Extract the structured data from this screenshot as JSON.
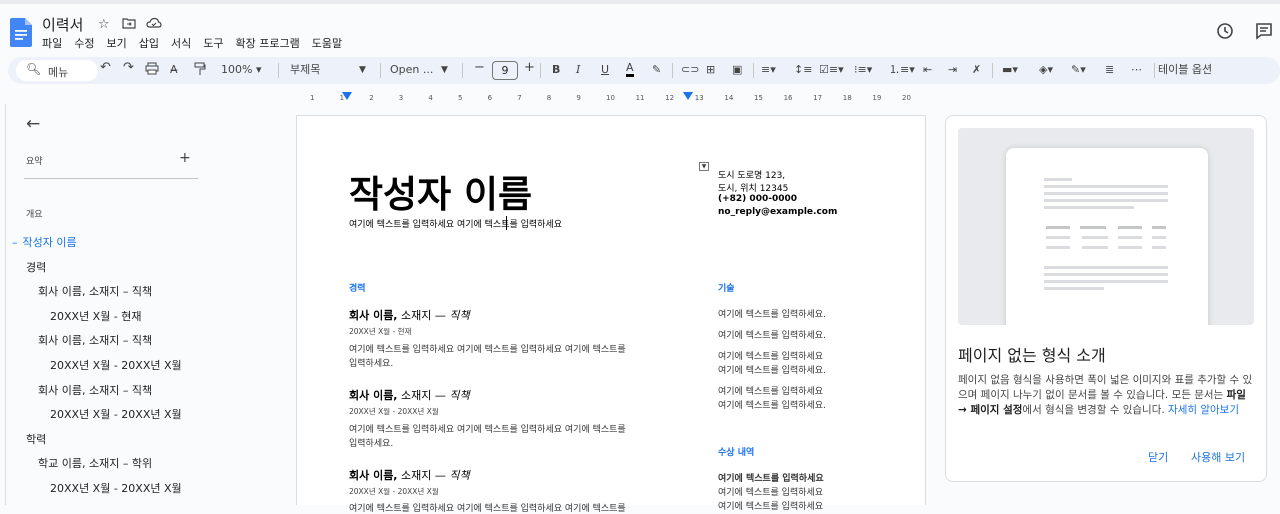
{
  "app": {
    "title": "이력서",
    "menu": [
      "파일",
      "수정",
      "보기",
      "삽입",
      "서식",
      "도구",
      "확장 프로그램",
      "도움말"
    ],
    "icons": [
      "star-icon",
      "move-to-folder-icon",
      "cloud-status-icon",
      "history-icon",
      "comments-icon"
    ]
  },
  "toolbar": {
    "search_label": "메뉴",
    "zoom": "100%",
    "style": "부제목",
    "font": "Open ...",
    "font_size": "9",
    "table_options": "테이블 옵션",
    "colors": {
      "accent": "#1a73e8",
      "toolbar_bg": "#edf2fa"
    }
  },
  "ruler": {
    "ticks": [
      "1",
      "1",
      "2",
      "3",
      "4",
      "5",
      "6",
      "7",
      "8",
      "9",
      "10",
      "11",
      "12",
      "13",
      "14",
      "15",
      "16",
      "17",
      "18",
      "19",
      "20"
    ]
  },
  "outline": {
    "summary_label": "요약",
    "overview_label": "개요",
    "items": [
      {
        "label": "작성자 이름",
        "level": 0,
        "active": true,
        "prefix": "–"
      },
      {
        "label": "경력",
        "level": 1
      },
      {
        "label": "회사 이름, 소재지 – 직책",
        "level": 2
      },
      {
        "label": "20XX년 X월 - 현재",
        "level": 3
      },
      {
        "label": "회사 이름, 소재지 – 직책",
        "level": 2
      },
      {
        "label": "20XX년 X월 - 20XX년 X월",
        "level": 3
      },
      {
        "label": "회사 이름, 소재지 – 직책",
        "level": 2
      },
      {
        "label": "20XX년 X월 - 20XX년 X월",
        "level": 3
      },
      {
        "label": "학력",
        "level": 1
      },
      {
        "label": "학교 이름, 소재지 – 학위",
        "level": 2
      },
      {
        "label": "20XX년 X월 - 20XX년 X월",
        "level": 3
      }
    ]
  },
  "document": {
    "author_name": "작성자 이름",
    "author_sub": "여기에 텍스트를 입력하세요 여기에 텍스트를 입력하세요",
    "contact": [
      "도시 도로명 123,",
      "도시, 위치 12345",
      "(+82) 000-0000",
      "no_reply@example.com"
    ],
    "experience_heading": "경력",
    "jobs": [
      {
        "company": "회사 이름,",
        "location": " 소재지 — ",
        "role": "직책",
        "dates": "20XX년 X월 - 현재",
        "desc1": "여기에 텍스트를 입력하세요 여기에 텍스트를 입력하세요 여기에 텍스트를",
        "desc2": "입력하세요."
      },
      {
        "company": "회사 이름,",
        "location": " 소재지 — ",
        "role": "직책",
        "dates": "20XX년 X월 - 20XX년 X월",
        "desc1": "여기에 텍스트를 입력하세요 여기에 텍스트를 입력하세요 여기에 텍스트를",
        "desc2": "입력하세요."
      },
      {
        "company": "회사 이름,",
        "location": " 소재지 — ",
        "role": "직책",
        "dates": "20XX년 X월 - 20XX년 X월",
        "desc1": "여기에 텍스트를 입력하세요 여기에 텍스트를 입력하세요 여기에 텍스트를",
        "desc2": ""
      }
    ],
    "skills_heading": "기술",
    "skills": [
      "여기에 텍스트를 입력하세요.",
      "여기에 텍스트를 입력하세요.",
      "여기에 텍스트를 입력하세요",
      "여기에 텍스트를 입력하세요.",
      "여기에 텍스트를 입력하세요",
      "여기에 텍스트를 입력하세요."
    ],
    "awards_heading": "수상 내역",
    "awards": [
      "여기에 텍스트를 입력하세요",
      "여기에 텍스트를 입력하세요",
      "여기에 텍스트를 입력하세요"
    ]
  },
  "intro_card": {
    "title": "페이지 없는 형식 소개",
    "body_1": "페이지 없음 형식을 사용하면 폭이 넓은 이미지와 표를 추가할 수 있으며 페이지 나누기 없이 문서를 볼 수 있습니다. 모든 문서는 ",
    "body_bold": "파일 → 페이지 설정",
    "body_2": "에서 형식을 변경할 수 있습니다. ",
    "link": "자세히 알아보기",
    "close": "닫기",
    "try": "사용해 보기"
  }
}
